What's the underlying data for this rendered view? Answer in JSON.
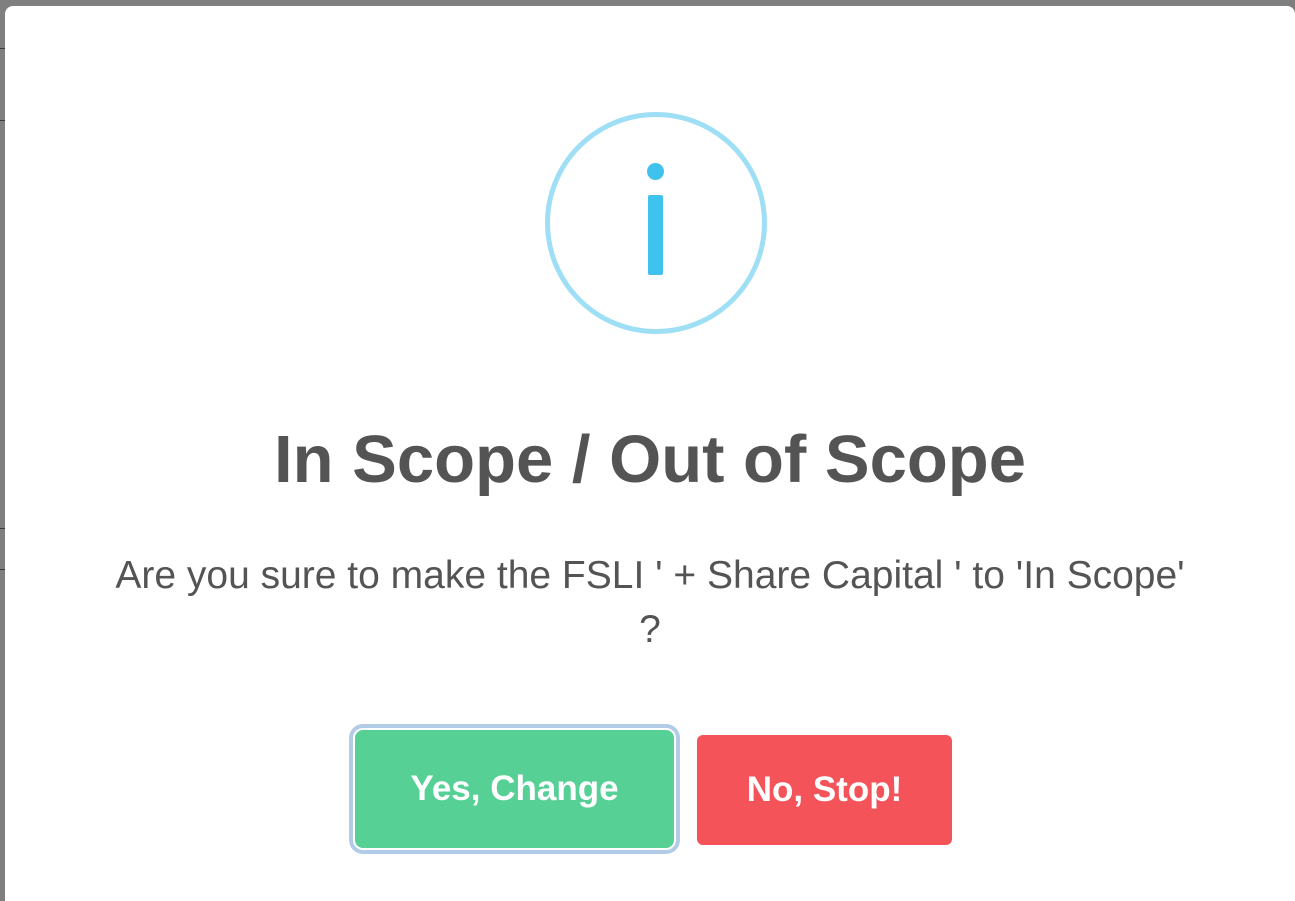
{
  "dialog": {
    "icon": "info-icon",
    "title": "In Scope / Out of Scope",
    "message": "Are you sure to make the FSLI ' + Share Capital ' to 'In Scope' ?",
    "confirm_label": "Yes, Change",
    "cancel_label": "No, Stop!"
  },
  "colors": {
    "icon_ring": "#9fdff5",
    "icon_glyph": "#3fc3ee",
    "confirm_button": "#57d096",
    "cancel_button": "#f45459",
    "text": "#545454"
  }
}
